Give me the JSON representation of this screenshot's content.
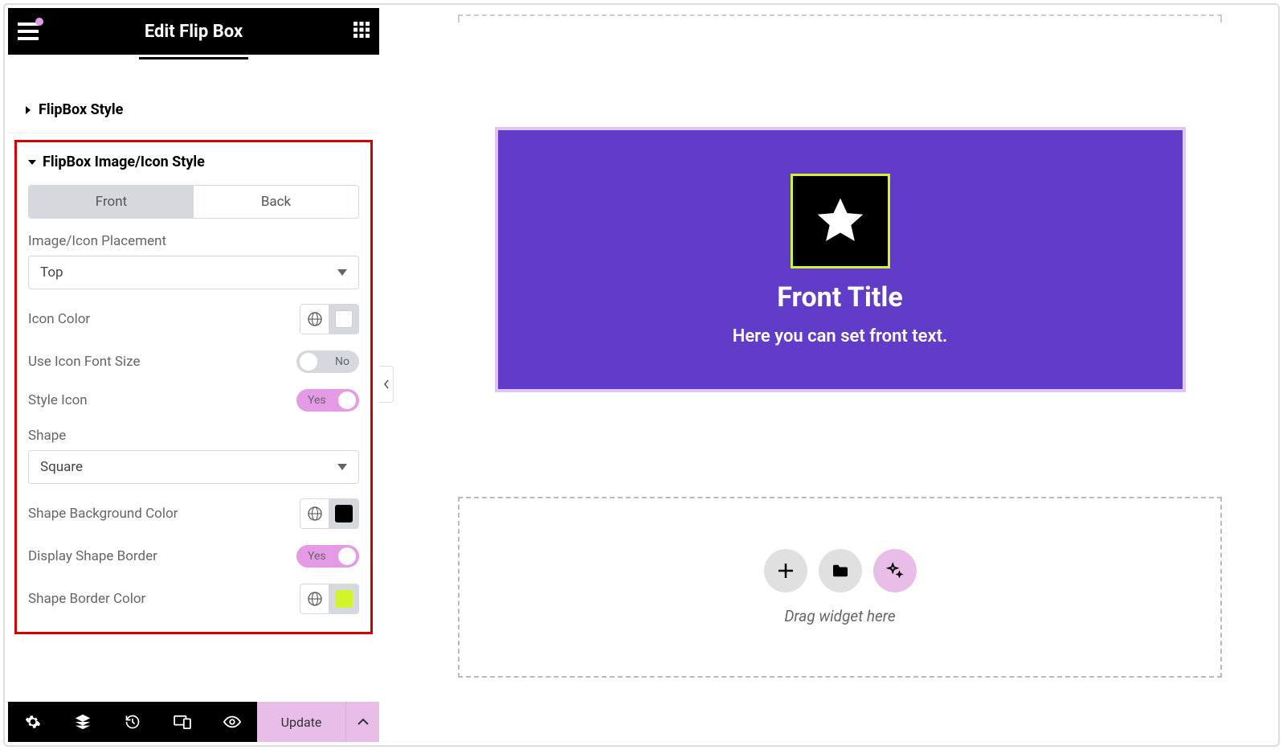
{
  "header": {
    "title": "Edit Flip Box"
  },
  "sections": {
    "flipbox_style": {
      "title": "FlipBox Style"
    },
    "image_icon_style": {
      "title": "FlipBox Image/Icon Style"
    }
  },
  "tabs": {
    "front": "Front",
    "back": "Back"
  },
  "controls": {
    "placement_label": "Image/Icon Placement",
    "placement_value": "Top",
    "icon_color_label": "Icon Color",
    "icon_color_value": "#ffffff",
    "use_font_size_label": "Use Icon Font Size",
    "use_font_size_value": "No",
    "style_icon_label": "Style Icon",
    "style_icon_value": "Yes",
    "shape_label": "Shape",
    "shape_value": "Square",
    "shape_bg_label": "Shape Background Color",
    "shape_bg_value": "#000000",
    "display_border_label": "Display Shape Border",
    "display_border_value": "Yes",
    "border_color_label": "Shape Border Color",
    "border_color_value": "#d0f52a"
  },
  "footer": {
    "update": "Update"
  },
  "preview": {
    "title": "Front Title",
    "text": "Here you can set front text.",
    "drop_text": "Drag widget here"
  }
}
